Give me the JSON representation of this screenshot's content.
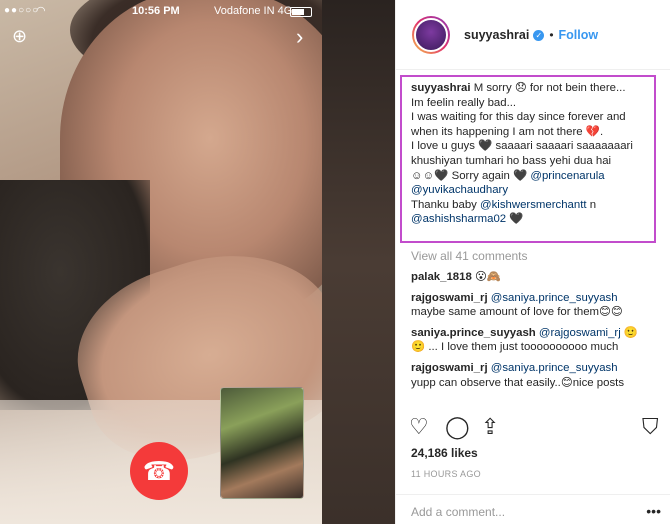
{
  "phone": {
    "status": {
      "signal": "●●○○○",
      "time": "10:56 PM",
      "carrier": "Vodafone IN  4G"
    }
  },
  "post": {
    "username": "suyyashrai",
    "follow_label": "Follow",
    "caption": {
      "author": "suyyashrai",
      "lines": [
        " M sorry 😞 for not bein there...",
        "Im feelin really bad...",
        "I was waiting for this day since forever and",
        "when its happening I am not there 💔.",
        "I love u guys 🖤 saaaari saaaari saaaaaaari",
        "khushiyan tumhari ho bass yehi dua hai",
        "☺☺🖤 Sorry again 🖤 "
      ],
      "mention1": "@princenarula",
      "mention2": "@yuvikachaudhary",
      "thanks": "Thanku baby ",
      "mention3": "@kishwersmerchantt",
      "n": " n",
      "mention4": "@ashishsharma02",
      "heart": " 🖤"
    },
    "view_all": "View all 41 comments",
    "comments": [
      {
        "user": "palak_1818",
        "text": " 😮🙈"
      },
      {
        "user": "rajgoswami_rj",
        "mention": "@saniya.prince_suyyash",
        "text": "maybe same amount of love for them😊😊"
      },
      {
        "user": "saniya.prince_suyyash",
        "mention": "@rajgoswami_rj",
        "text": "🙂 ... I love them just toooooooooo much"
      },
      {
        "user": "rajgoswami_rj",
        "mention": "@saniya.prince_suyyash",
        "text": "yupp can observe that easily..😊nice posts"
      }
    ],
    "likes": "24,186 likes",
    "timestamp": "11 HOURS AGO",
    "add_comment_placeholder": "Add a comment...",
    "more": "•••"
  },
  "icons": [
    "heart-icon",
    "comment-icon",
    "share-icon",
    "bookmark-icon",
    "end-call-icon",
    "add-person-icon",
    "chevron-right-icon"
  ]
}
